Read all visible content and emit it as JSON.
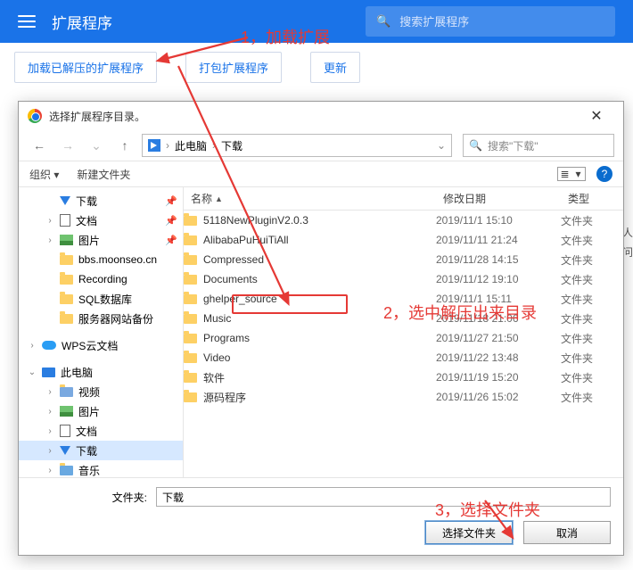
{
  "chrome": {
    "title": "扩展程序",
    "search_placeholder": "搜索扩展程序"
  },
  "actions": {
    "load_unpacked": "加载已解压的扩展程序",
    "pack": "打包扩展程序",
    "update": "更新"
  },
  "annotations": {
    "a1": "1，加载扩展",
    "a2": "2，选中解压出来目录",
    "a3": "3，选择文件夹"
  },
  "dialog": {
    "title": "选择扩展程序目录。",
    "breadcrumb": {
      "root": "此电脑",
      "folder": "下载"
    },
    "search_placeholder": "搜索\"下载\"",
    "toolbar": {
      "organize": "组织 ▾",
      "new_folder": "新建文件夹"
    },
    "columns": {
      "name": "名称",
      "date": "修改日期",
      "type": "类型"
    },
    "folder_label": "文件夹:",
    "folder_value": "下载",
    "ok": "选择文件夹",
    "cancel": "取消"
  },
  "tree": {
    "downloads": "下载",
    "documents": "文档",
    "pictures": "图片",
    "bbs": "bbs.moonseo.cn",
    "recording": "Recording",
    "sqldb": "SQL数据库",
    "server_backup": "服务器网站备份",
    "wps": "WPS云文档",
    "this_pc": "此电脑",
    "videos": "视频",
    "pictures2": "图片",
    "documents2": "文档",
    "downloads2": "下载",
    "music": "音乐"
  },
  "files": [
    {
      "name": "5118NewPluginV2.0.3",
      "date": "2019/11/1 15:10",
      "type": "文件夹"
    },
    {
      "name": "AlibabaPuHuiTiAll",
      "date": "2019/11/11 21:24",
      "type": "文件夹"
    },
    {
      "name": "Compressed",
      "date": "2019/11/28 14:15",
      "type": "文件夹"
    },
    {
      "name": "Documents",
      "date": "2019/11/12 19:10",
      "type": "文件夹"
    },
    {
      "name": "ghelper_source",
      "date": "2019/11/1 15:11",
      "type": "文件夹"
    },
    {
      "name": "Music",
      "date": "2019/11/18 21:06",
      "type": "文件夹"
    },
    {
      "name": "Programs",
      "date": "2019/11/27 21:50",
      "type": "文件夹"
    },
    {
      "name": "Video",
      "date": "2019/11/22 13:48",
      "type": "文件夹"
    },
    {
      "name": "软件",
      "date": "2019/11/19 15:20",
      "type": "文件夹"
    },
    {
      "name": "源码程序",
      "date": "2019/11/26 15:02",
      "type": "文件夹"
    }
  ],
  "side_crop": {
    "l1": "人",
    "l2": "问"
  }
}
